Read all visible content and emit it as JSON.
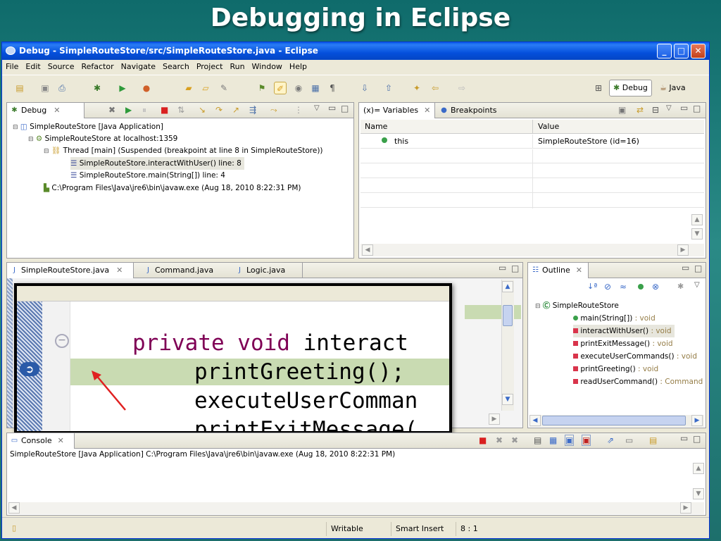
{
  "slide": {
    "title": "Debugging in Eclipse"
  },
  "window": {
    "title": "Debug - SimpleRouteStore/src/SimpleRouteStore.java - Eclipse"
  },
  "menu": [
    "File",
    "Edit",
    "Source",
    "Refactor",
    "Navigate",
    "Search",
    "Project",
    "Run",
    "Window",
    "Help"
  ],
  "perspectives": {
    "debug": "Debug",
    "java": "Java"
  },
  "debug_view": {
    "tab": "Debug",
    "tree": [
      "SimpleRouteStore [Java Application]",
      "SimpleRouteStore at localhost:1359",
      "Thread [main] (Suspended (breakpoint at line 8 in SimpleRouteStore))",
      "SimpleRouteStore.interactWithUser() line: 8",
      "SimpleRouteStore.main(String[]) line: 4",
      "C:\\Program Files\\Java\\jre6\\bin\\javaw.exe (Aug 18, 2010 8:22:31 PM)"
    ]
  },
  "variables_view": {
    "tab_variables": "(x)= Variables",
    "tab_breakpoints": "Breakpoints",
    "col_name": "Name",
    "col_value": "Value",
    "rows": [
      {
        "name": "this",
        "value": "SimpleRouteStore  (id=16)"
      }
    ]
  },
  "editor": {
    "tabs": [
      "SimpleRouteStore.java",
      "Command.java",
      "Logic.java"
    ],
    "zoom_lines": {
      "kw": "private void",
      "rest": " interact",
      "call1": "printGreeting();",
      "call2": "executeUserComman",
      "call3": "printExitMessage("
    }
  },
  "outline": {
    "tab": "Outline",
    "root": "SimpleRouteStore",
    "items": [
      {
        "name": "main(String[])",
        "type": " : void"
      },
      {
        "name": "interactWithUser()",
        "type": " : void"
      },
      {
        "name": "printExitMessage()",
        "type": " : void"
      },
      {
        "name": "executeUserCommands()",
        "type": " : void"
      },
      {
        "name": "printGreeting()",
        "type": " : void"
      },
      {
        "name": "readUserCommand()",
        "type": " : Command"
      }
    ]
  },
  "console": {
    "tab": "Console",
    "text": "SimpleRouteStore [Java Application] C:\\Program Files\\Java\\jre6\\bin\\javaw.exe (Aug 18, 2010 8:22:31 PM)"
  },
  "status": {
    "mode": "Writable",
    "insert": "Smart Insert",
    "position": "8 : 1"
  },
  "colors": {
    "keyword": "#7f0055",
    "current_line": "#c9dbb2",
    "accent": "#0550dc"
  }
}
